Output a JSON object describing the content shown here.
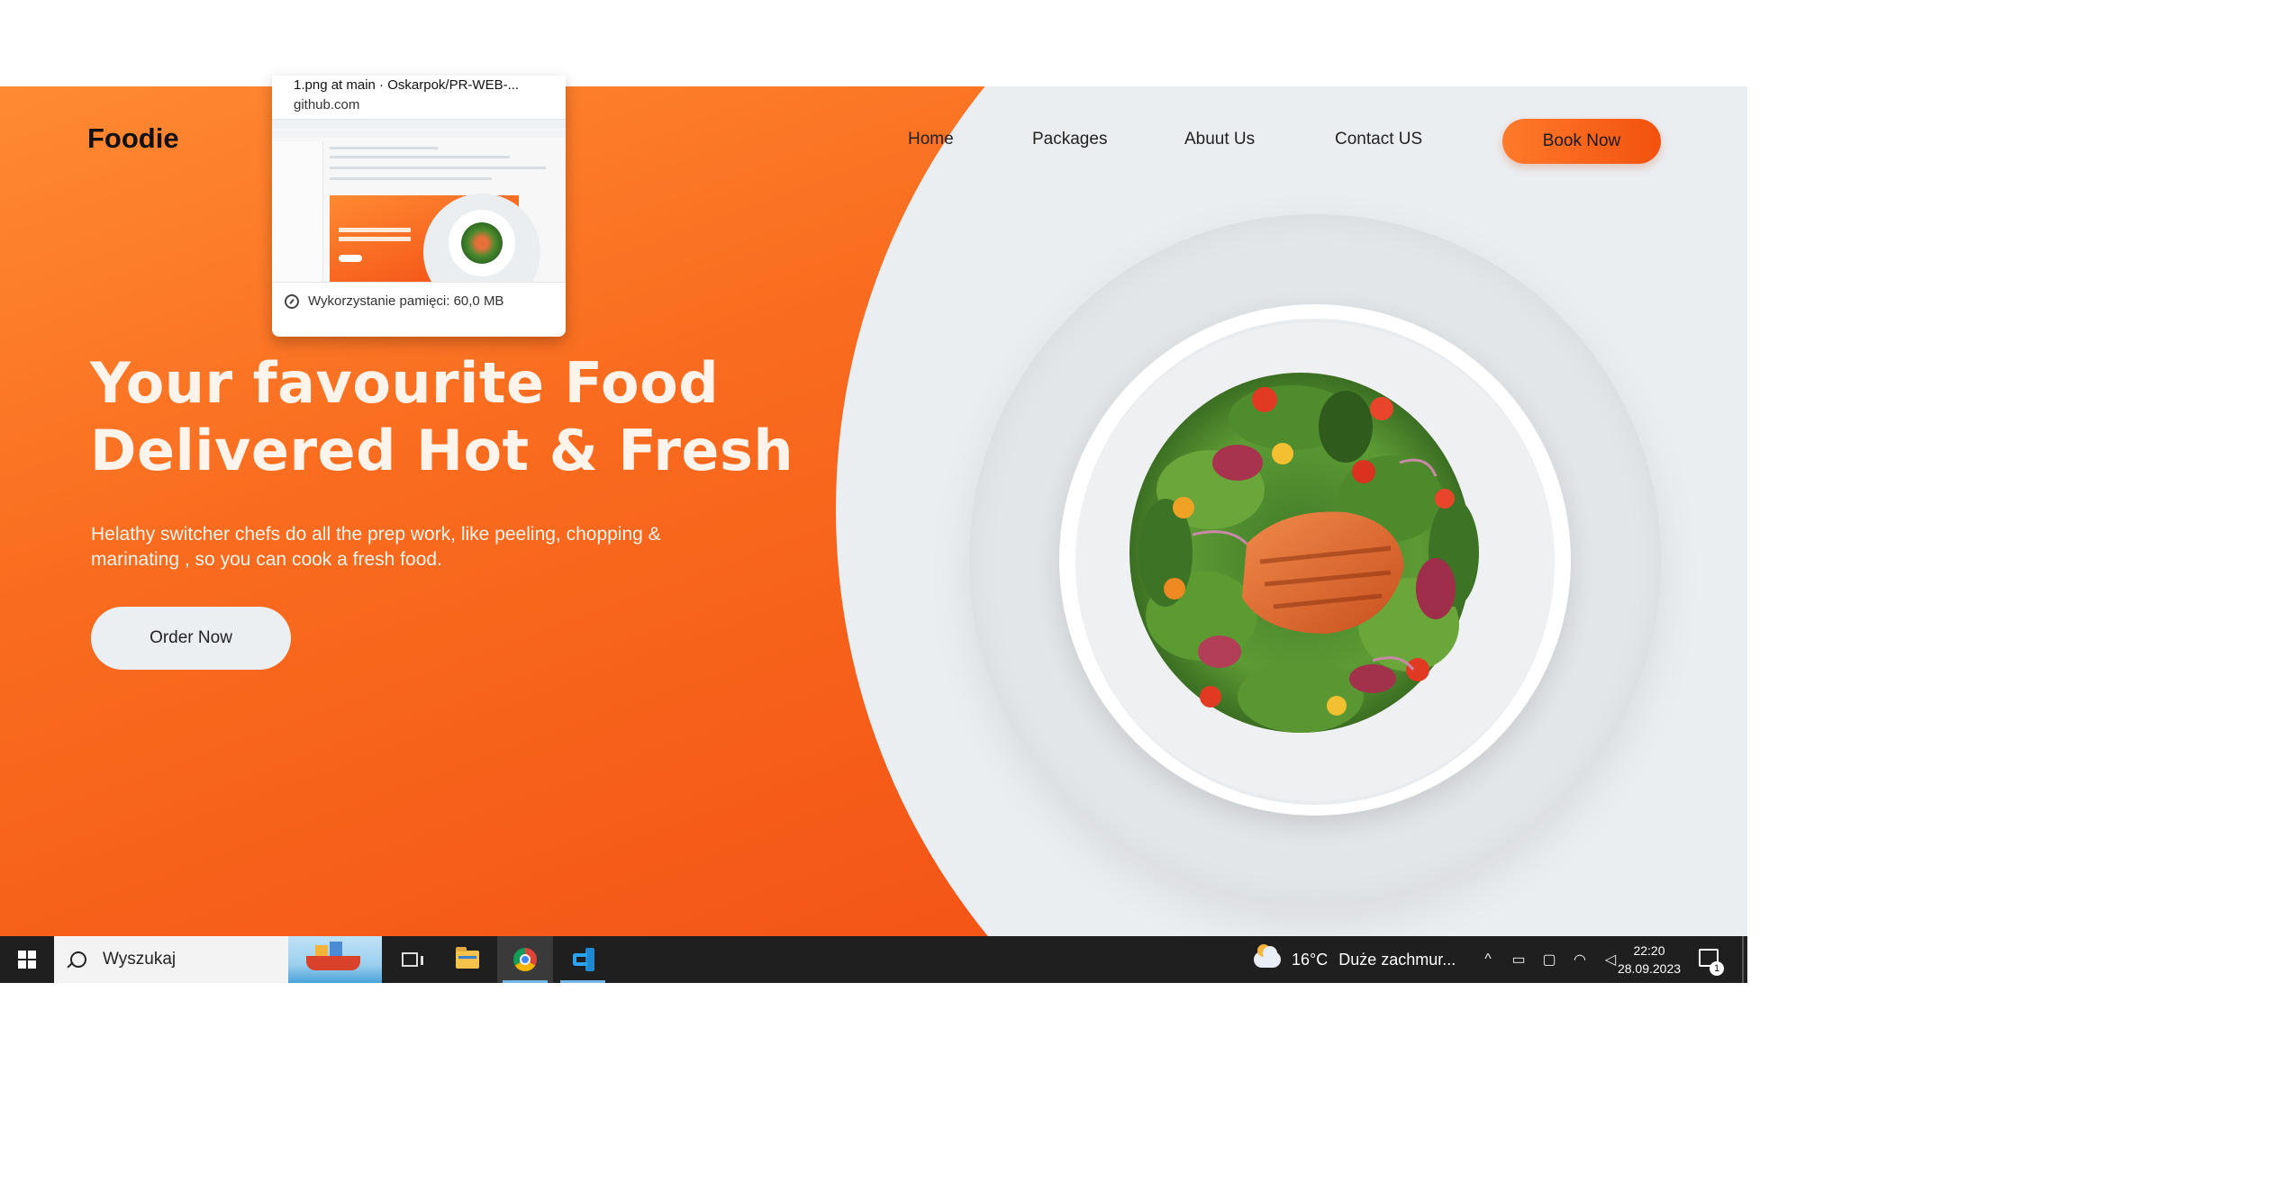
{
  "site": {
    "logo": "Foodie",
    "nav": [
      "Home",
      "Packages",
      "Abuut Us",
      "Contact US"
    ],
    "book_button": "Book Now",
    "hero_title_line1": "Your favourite Food",
    "hero_title_line2": "Delivered Hot & Fresh",
    "hero_subtitle_line1": "Helathy switcher chefs do all the prep work, like peeling, chopping &",
    "hero_subtitle_line2": "marinating , so you can cook a fresh food.",
    "order_button": "Order Now",
    "colors": {
      "accent_start": "#ff8a33",
      "accent_end": "#f24c12",
      "plate_bg": "#ebeef1"
    }
  },
  "tab_preview": {
    "title": "1.png at main · Oskarpok/PR-WEB-...",
    "domain": "github.com",
    "memory": "Wykorzystanie pamięci: 60,0 MB"
  },
  "taskbar": {
    "search_placeholder": "Wyszukaj",
    "icons": [
      "windows-start-icon",
      "search-icon",
      "task-view-icon",
      "file-explorer-icon",
      "chrome-icon",
      "vscode-icon"
    ],
    "weather_temp": "16°C",
    "weather_desc": "Duże zachmur...",
    "time": "22:20",
    "date": "28.09.2023",
    "notification_count": "1"
  }
}
